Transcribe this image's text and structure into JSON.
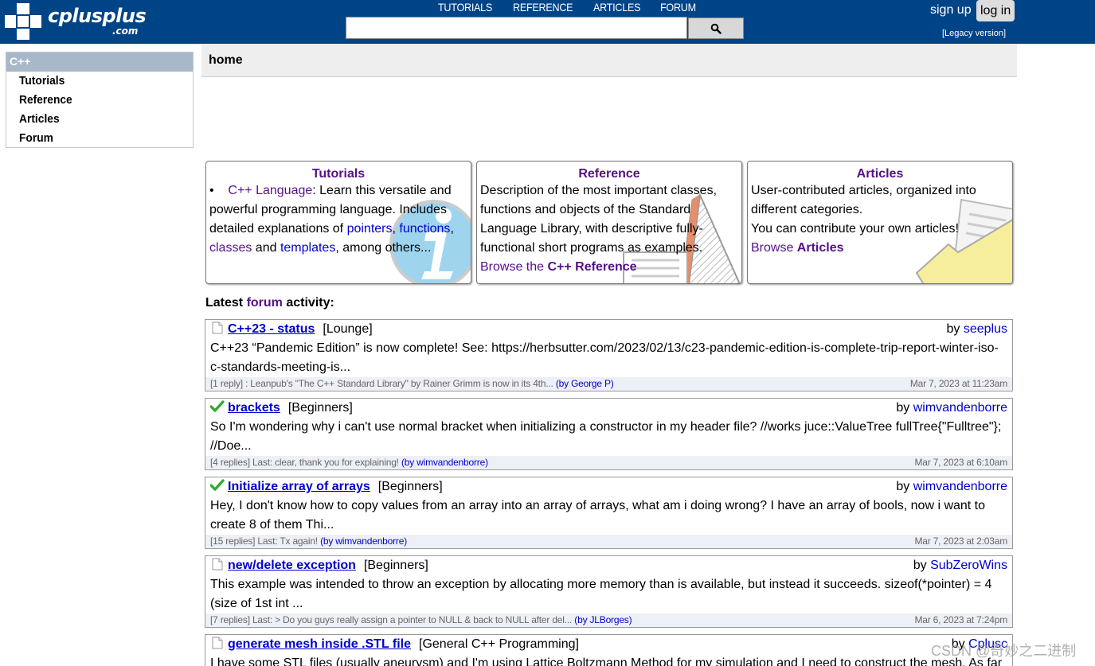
{
  "header": {
    "logo_text": "cplusplus",
    "logo_sub": ".com",
    "nav": [
      "TUTORIALS",
      "REFERENCE",
      "ARTICLES",
      "FORUM"
    ],
    "search_placeholder": "",
    "signup": "sign up",
    "login": "log in",
    "legacy": "[Legacy version]"
  },
  "sidebar": {
    "heading": "C++",
    "items": [
      "Tutorials",
      "Reference",
      "Articles",
      "Forum"
    ]
  },
  "breadcrumb": "home",
  "boxes": {
    "tutorials": {
      "title": "Tutorials",
      "link": "C++ Language",
      "t1": ": Learn this versatile and powerful programming language. Includes detailed explanations of ",
      "l_pointers": "pointers",
      "c1": ", ",
      "l_functions": "functions",
      "c2": ", ",
      "l_classes": "classes",
      "and": " and ",
      "l_templates": "templates",
      "t2": ", among others..."
    },
    "reference": {
      "title": "Reference",
      "text": "Description of the most important classes, functions and objects of the Standard Language Library, with descriptive fully-functional short programs as examples.",
      "browse_pre": "Browse the ",
      "browse_bold": "C++ Reference"
    },
    "articles": {
      "title": "Articles",
      "text1": "User-contributed articles, organized into different categories.",
      "text2": "You can contribute your own articles!",
      "browse_pre": "Browse ",
      "browse_bold": "Articles"
    }
  },
  "latest": {
    "pre": "Latest ",
    "link": "forum",
    "post": " activity:"
  },
  "posts": [
    {
      "icon": "page-icon",
      "title": "C++23 - status",
      "category": "[Lounge]",
      "by_label": "by ",
      "author": "seeplus",
      "body": "C++23 “Pandemic Edition” is now complete! See: https://herbsutter.com/2023/02/13/c23-pandemic-edition-is-complete-trip-report-winter-iso-c-standards-meeting-is...",
      "foot_pre": "[1 reply] : ",
      "foot_link": "Leanpub's \"The C++ Standard Library\" by Rainer Grimm is now in its 4th...",
      "foot_by": "(by George P)",
      "date": "Mar 7, 2023 at 11:23am"
    },
    {
      "icon": "check-icon",
      "title": "brackets",
      "category": "[Beginners]",
      "by_label": "by ",
      "author": "wimvandenborre",
      "body": "So I'm wondering why i can't use normal bracket when initializing a constructor in my header file? //works juce::ValueTree fullTree{\"Fulltree\"}; //Doe...",
      "foot_pre": "[4 replies] Last: ",
      "foot_link": "clear, thank you for explaining!",
      "foot_by": "(by wimvandenborre)",
      "date": "Mar 7, 2023 at 6:10am"
    },
    {
      "icon": "check-icon",
      "title": "Initialize array of arrays",
      "category": "[Beginners]",
      "by_label": "by ",
      "author": "wimvandenborre",
      "body": "Hey, I don't know how to copy values from an array into an array of arrays, what am i doing wrong? I have an array of bools, now i want to create 8 of them Thi...",
      "foot_pre": "[15 replies] Last: ",
      "foot_link": "Tx again!",
      "foot_by": "(by wimvandenborre)",
      "date": "Mar 7, 2023 at 2:03am"
    },
    {
      "icon": "page-icon",
      "title": "new/delete exception",
      "category": "[Beginners]",
      "by_label": "by ",
      "author": "SubZeroWins",
      "body": "This example was intended to throw an exception by allocating more memory than is available, but instead it succeeds. sizeof(*pointer) = 4 (size of 1st int ...",
      "foot_pre": "[7 replies] Last: ",
      "foot_link": "> Do you guys really assign a pointer to NULL & back to NULL after del...",
      "foot_by": "(by JLBorges)",
      "date": "Mar 6, 2023 at 7:24pm"
    },
    {
      "icon": "page-icon",
      "title": "generate mesh inside .STL file",
      "category": "[General C++ Programming]",
      "by_label": "by ",
      "author": "Cplusc",
      "body": "I have some STL files (usually aneurysm) and I'm using Lattice Boltzmann Method for my simulation and I need to construct the mesh. As far",
      "foot_pre": "",
      "foot_link": "",
      "foot_by": "",
      "date": ""
    }
  ],
  "watermark": "CSDN @奇妙之二进制"
}
